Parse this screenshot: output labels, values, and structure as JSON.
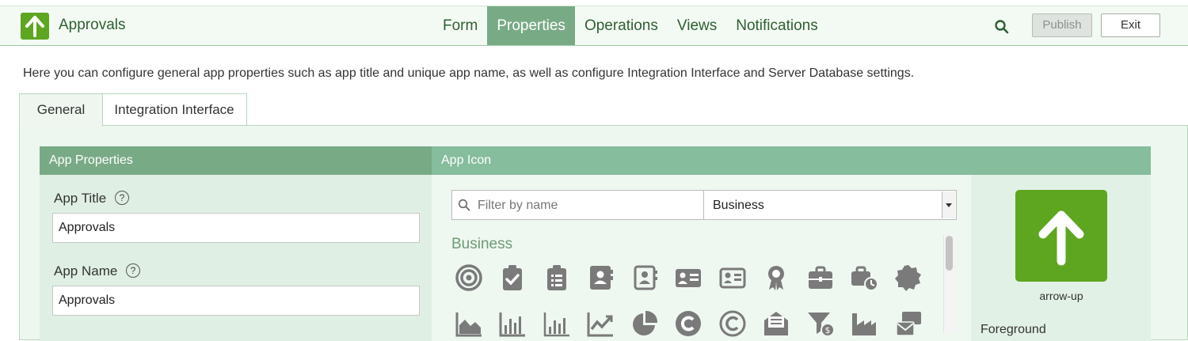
{
  "app": {
    "title": "Approvals",
    "logo_icon": "arrow-up-icon",
    "brand_color": "#5ea61f"
  },
  "nav": {
    "items": [
      "Form",
      "Properties",
      "Operations",
      "Views",
      "Notifications"
    ],
    "active": "Properties"
  },
  "toolbar": {
    "search_icon": "search-icon",
    "publish_label": "Publish",
    "exit_label": "Exit"
  },
  "intro": "Here you can configure general app properties such as app title and unique app name, as well as configure Integration Interface and Server Database settings.",
  "tabs": {
    "items": [
      "General",
      "Integration Interface"
    ],
    "active": "General"
  },
  "props": {
    "header": "App Properties",
    "app_title_label": "App Title",
    "app_title_value": "Approvals",
    "app_name_label": "App Name",
    "app_name_value": "Approvals",
    "help_glyph": "?"
  },
  "icon_picker": {
    "header": "App Icon",
    "filter_placeholder": "Filter by name",
    "category": "Business",
    "group_title": "Business",
    "icons": [
      "bullseye-icon",
      "clipboard-check-icon",
      "clipboard-list-icon",
      "address-book-icon",
      "address-book-outline-icon",
      "id-card-icon",
      "id-card-outline-icon",
      "award-icon",
      "briefcase-icon",
      "business-time-icon",
      "certificate-icon",
      "chart-area-icon",
      "chart-bar-icon",
      "chart-bar-outline-icon",
      "chart-line-icon",
      "chart-pie-icon",
      "copyright-icon",
      "copyright-outline-icon",
      "envelope-open-text-icon",
      "funnel-dollar-icon",
      "industry-icon",
      "mail-bulk-icon"
    ]
  },
  "preview": {
    "icon_name": "arrow-up",
    "foreground_label": "Foreground"
  },
  "colors": {
    "header_dark": "#79aa86",
    "header_light": "#86bd9c",
    "panel_bg": "#edf6ef",
    "text_green": "#2f5f33"
  }
}
